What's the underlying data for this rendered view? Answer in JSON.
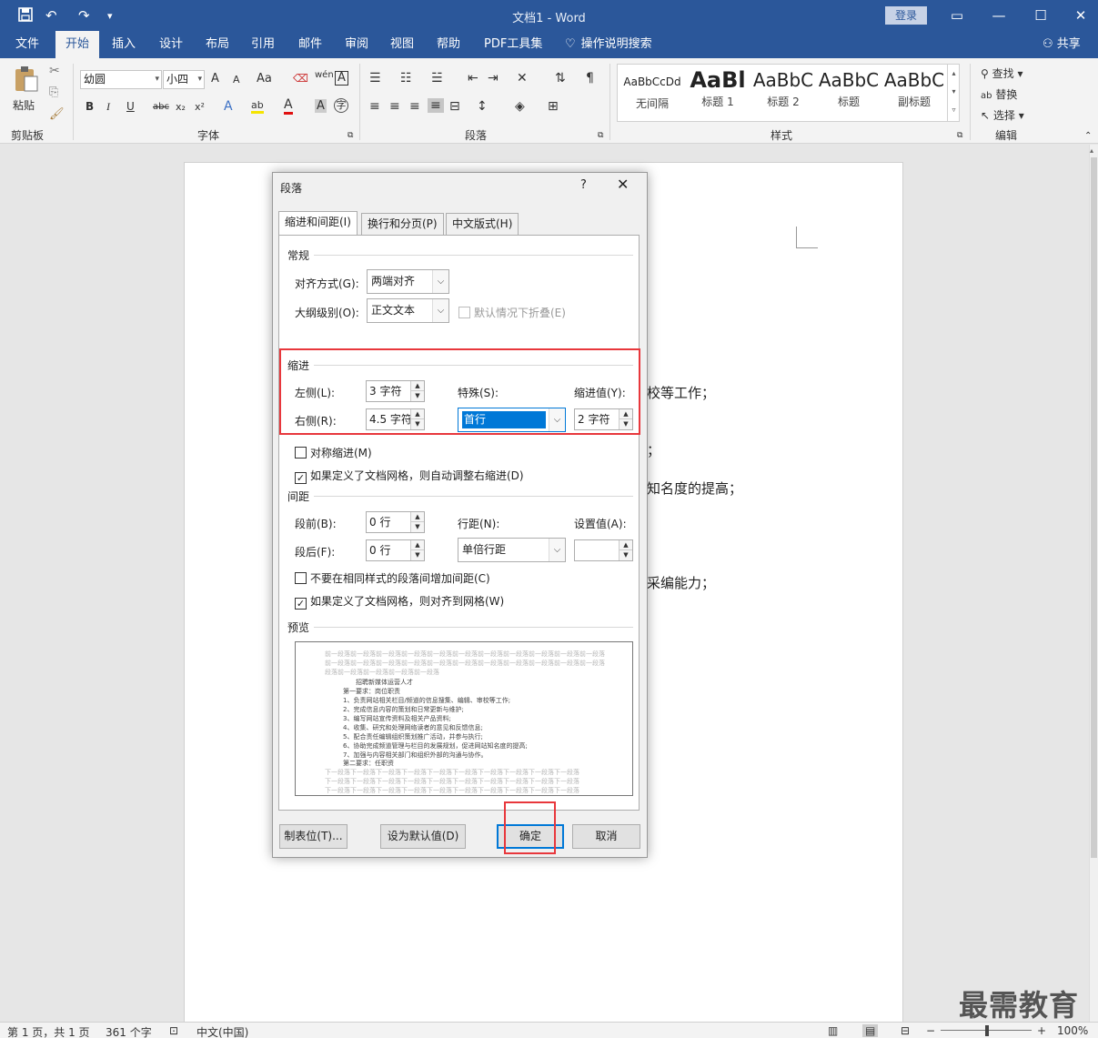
{
  "app": {
    "title": "文档1  -  Word",
    "login_label": "登录",
    "share_label": "共享",
    "quick_access": [
      "save-icon",
      "undo-icon",
      "redo-icon",
      "customize-icon"
    ],
    "window_buttons": {
      "ribbon_display": "▭",
      "minimize": "—",
      "maximize": "☐",
      "close": "✕"
    }
  },
  "tabs": [
    "文件",
    "开始",
    "插入",
    "设计",
    "布局",
    "引用",
    "邮件",
    "审阅",
    "视图",
    "帮助",
    "PDF工具集",
    "操作说明搜索"
  ],
  "active_tab": "开始",
  "ribbon": {
    "clipboard": {
      "paste": "粘贴",
      "label": "剪贴板"
    },
    "font": {
      "font_name": "幼圆",
      "font_size": "小四",
      "label": "字体",
      "buttons": [
        "A",
        "A",
        "Aa",
        "wén",
        "A",
        "B",
        "I",
        "U",
        "abc",
        "x₂",
        "x²",
        "A",
        "ab",
        "A",
        "A",
        "A",
        "字"
      ]
    },
    "paragraph": {
      "label": "段落"
    },
    "styles": {
      "label": "样式",
      "items": [
        {
          "preview": "AaBbCcDd",
          "name": "无间隔"
        },
        {
          "preview": "AaBl",
          "name": "标题 1"
        },
        {
          "preview": "AaBbC",
          "name": "标题 2"
        },
        {
          "preview": "AaBbC",
          "name": "标题"
        },
        {
          "preview": "AaBbC",
          "name": "副标题"
        }
      ]
    },
    "editing": {
      "find": "查找",
      "replace": "替换",
      "select": "选择",
      "label": "编辑"
    }
  },
  "document": {
    "fragments": [
      "校等工作；",
      "；",
      "知名度的提高；",
      "采编能力；"
    ]
  },
  "dialog": {
    "title": "段落",
    "help": "?",
    "close": "✕",
    "tabs": [
      {
        "label": "缩进和间距(I)",
        "key": "I"
      },
      {
        "label": "换行和分页(P)",
        "key": "P"
      },
      {
        "label": "中文版式(H)",
        "key": "H"
      }
    ],
    "general": {
      "heading": "常规",
      "alignment_label": "对齐方式(G):",
      "alignment_value": "两端对齐",
      "outline_label": "大纲级别(O):",
      "outline_value": "正文文本",
      "collapse_label": "默认情况下折叠(E)"
    },
    "indent": {
      "heading": "缩进",
      "left_label": "左侧(L):",
      "left_value": "3 字符",
      "right_label": "右侧(R):",
      "right_value": "4.5 字符",
      "special_label": "特殊(S):",
      "special_value": "首行",
      "by_label": "缩进值(Y):",
      "by_value": "2 字符",
      "mirror_label": "对称缩进(M)",
      "auto_adjust_label": "如果定义了文档网格，则自动调整右缩进(D)"
    },
    "spacing": {
      "heading": "间距",
      "before_label": "段前(B):",
      "before_value": "0 行",
      "after_label": "段后(F):",
      "after_value": "0 行",
      "line_spacing_label": "行距(N):",
      "line_spacing_value": "单倍行距",
      "at_label": "设置值(A):",
      "at_value": "",
      "no_space_label": "不要在相同样式的段落间增加间距(C)",
      "snap_grid_label": "如果定义了文档网格，则对齐到网格(W)"
    },
    "preview": {
      "heading": "预览",
      "prev_para": "前一段落前一段落前一段落前一段落前一段落前一段落前一段落前一段落前一段落前一段落前一段落",
      "prev_para_end": "段落前一段落前一段落前一段落前一段落",
      "body_lines": [
        "招聘新媒体运营人才",
        "第一要求：岗位职责",
        "1、负责网站相关栏目/频道的信息搜集、编辑、审校等工作;",
        "2、完成信息内容的策划和日常更新与维护;",
        "3、编写网站宣传资料及相关产品资料;",
        "4、收集、研究和处理网络读者的意见和反馈信息;",
        "5、配合责任编辑组织策划推广活动，并参与执行;",
        "6、协助完成频道管理与栏目的发展规划，促进网站知名度的提高;",
        "7、加强与内容相关部门和组织外部的沟通与协作。",
        "第二要求：任职资"
      ],
      "next_para": "下一段落下一段落下一段落下一段落下一段落下一段落下一段落下一段落下一段落下一段落"
    },
    "buttons": {
      "tabs_button": "制表位(T)...",
      "set_default": "设为默认值(D)",
      "ok": "确定",
      "cancel": "取消"
    }
  },
  "status": {
    "page": "第 1 页，共 1 页",
    "words": "361 个字",
    "language": "中文(中国)",
    "zoom": "100%"
  },
  "watermark": "最需教育",
  "colors": {
    "brand": "#2b579a",
    "highlight_red": "#e8373c",
    "focus_blue": "#0078d7"
  }
}
